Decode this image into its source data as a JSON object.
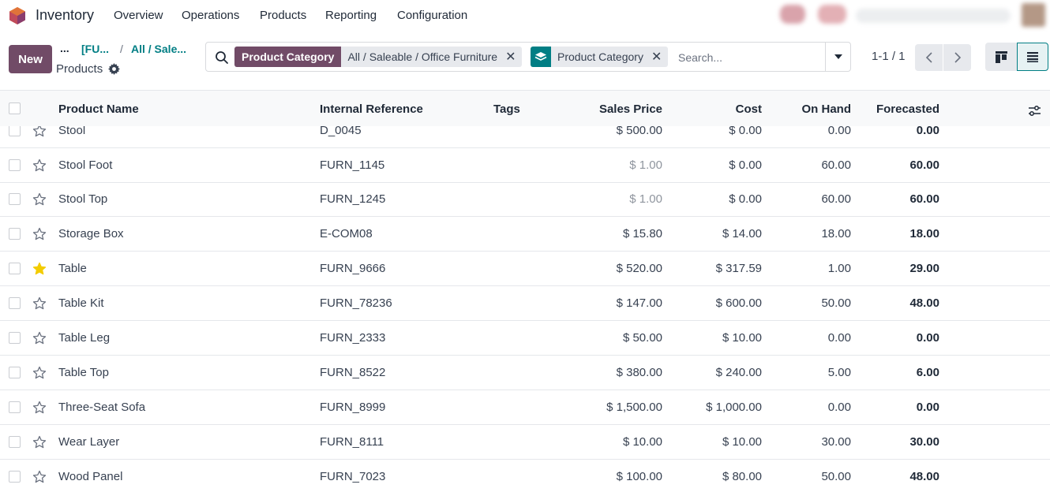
{
  "navbar": {
    "app_name": "Inventory",
    "menu": [
      "Overview",
      "Operations",
      "Products",
      "Reporting",
      "Configuration"
    ]
  },
  "control": {
    "new_label": "New",
    "breadcrumb": {
      "dots": "...",
      "link1": "[FU...",
      "separator": "/",
      "link2": "All / Sale...",
      "current": "Products"
    }
  },
  "search": {
    "facets": [
      {
        "label": "Product Category",
        "value": "All / Saleable / Office Furniture",
        "color": "#714b67"
      },
      {
        "label": "Product Category",
        "color": "#017e84",
        "icon": "layers-icon"
      }
    ],
    "placeholder": "Search..."
  },
  "pager": {
    "value": "1-1 / 1"
  },
  "colors": {
    "primary": "#714b67",
    "accent": "#017e84",
    "favorite": "#f3cc00"
  },
  "table": {
    "columns": [
      "Product Name",
      "Internal Reference",
      "Tags",
      "Sales Price",
      "Cost",
      "On Hand",
      "Forecasted"
    ],
    "rows": [
      {
        "name": "Stool",
        "ref": "D_0045",
        "tags": "",
        "price": "$ 500.00",
        "price_muted": false,
        "cost": "$ 0.00",
        "on_hand": "0.00",
        "forecasted": "0.00",
        "favorite": false
      },
      {
        "name": "Stool Foot",
        "ref": "FURN_1145",
        "tags": "",
        "price": "$ 1.00",
        "price_muted": true,
        "cost": "$ 0.00",
        "on_hand": "60.00",
        "forecasted": "60.00",
        "favorite": false
      },
      {
        "name": "Stool Top",
        "ref": "FURN_1245",
        "tags": "",
        "price": "$ 1.00",
        "price_muted": true,
        "cost": "$ 0.00",
        "on_hand": "60.00",
        "forecasted": "60.00",
        "favorite": false
      },
      {
        "name": "Storage Box",
        "ref": "E-COM08",
        "tags": "",
        "price": "$ 15.80",
        "price_muted": false,
        "cost": "$ 14.00",
        "on_hand": "18.00",
        "forecasted": "18.00",
        "favorite": false
      },
      {
        "name": "Table",
        "ref": "FURN_9666",
        "tags": "",
        "price": "$ 520.00",
        "price_muted": false,
        "cost": "$ 317.59",
        "on_hand": "1.00",
        "forecasted": "29.00",
        "favorite": true
      },
      {
        "name": "Table Kit",
        "ref": "FURN_78236",
        "tags": "",
        "price": "$ 147.00",
        "price_muted": false,
        "cost": "$ 600.00",
        "on_hand": "50.00",
        "forecasted": "48.00",
        "favorite": false
      },
      {
        "name": "Table Leg",
        "ref": "FURN_2333",
        "tags": "",
        "price": "$ 50.00",
        "price_muted": false,
        "cost": "$ 10.00",
        "on_hand": "0.00",
        "forecasted": "0.00",
        "favorite": false
      },
      {
        "name": "Table Top",
        "ref": "FURN_8522",
        "tags": "",
        "price": "$ 380.00",
        "price_muted": false,
        "cost": "$ 240.00",
        "on_hand": "5.00",
        "forecasted": "6.00",
        "favorite": false
      },
      {
        "name": "Three-Seat Sofa",
        "ref": "FURN_8999",
        "tags": "",
        "price": "$ 1,500.00",
        "price_muted": false,
        "cost": "$ 1,000.00",
        "on_hand": "0.00",
        "forecasted": "0.00",
        "favorite": false
      },
      {
        "name": "Wear Layer",
        "ref": "FURN_8111",
        "tags": "",
        "price": "$ 10.00",
        "price_muted": false,
        "cost": "$ 10.00",
        "on_hand": "30.00",
        "forecasted": "30.00",
        "favorite": false
      },
      {
        "name": "Wood Panel",
        "ref": "FURN_7023",
        "tags": "",
        "price": "$ 100.00",
        "price_muted": false,
        "cost": "$ 80.00",
        "on_hand": "50.00",
        "forecasted": "48.00",
        "favorite": false
      }
    ]
  }
}
